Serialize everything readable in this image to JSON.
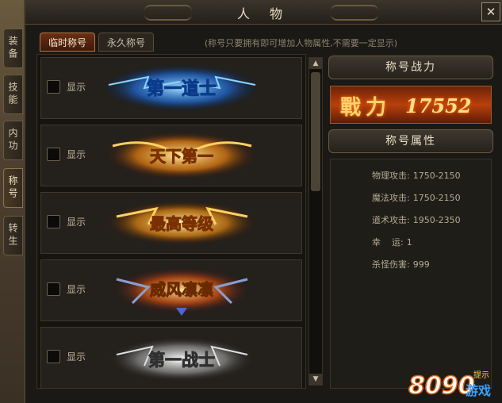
{
  "window": {
    "title": "人 物",
    "close_label": "✕"
  },
  "side_tabs": [
    {
      "label": "装备",
      "active": false
    },
    {
      "label": "技能",
      "active": false
    },
    {
      "label": "内功",
      "active": false
    },
    {
      "label": "称号",
      "active": true
    },
    {
      "label": "转生",
      "active": false
    }
  ],
  "tabs": [
    {
      "label": "临时称号",
      "active": true
    },
    {
      "label": "永久称号",
      "active": false
    }
  ],
  "hint": "(称号只要拥有即可增加人物属性,不需要一定显示)",
  "titles": [
    {
      "show_label": "显示",
      "badge_text": "第一道士",
      "color": "#4aa8ff"
    },
    {
      "show_label": "显示",
      "badge_text": "天下第一",
      "color": "#ffb020"
    },
    {
      "show_label": "显示",
      "badge_text": "最高等级",
      "color": "#ffb020"
    },
    {
      "show_label": "显示",
      "badge_text": "威风凛凛",
      "color": "#ff9020"
    },
    {
      "show_label": "显示",
      "badge_text": "第一战士",
      "color": "#e8e8e8"
    }
  ],
  "power": {
    "header": "称号战力",
    "label": "戰力",
    "value": "17552"
  },
  "attributes": {
    "header": "称号属性",
    "items": [
      {
        "name": "物理攻击:",
        "value": "1750-2150"
      },
      {
        "name": "魔法攻击:",
        "value": "1750-2150"
      },
      {
        "name": "道术攻击:",
        "value": "1950-2350"
      },
      {
        "name": "幸    运:",
        "value": "1"
      },
      {
        "name": "杀怪伤害:",
        "value": "999"
      }
    ]
  },
  "watermark": {
    "brand": "8090",
    "suffix": "游戏",
    "tag": "提示"
  }
}
